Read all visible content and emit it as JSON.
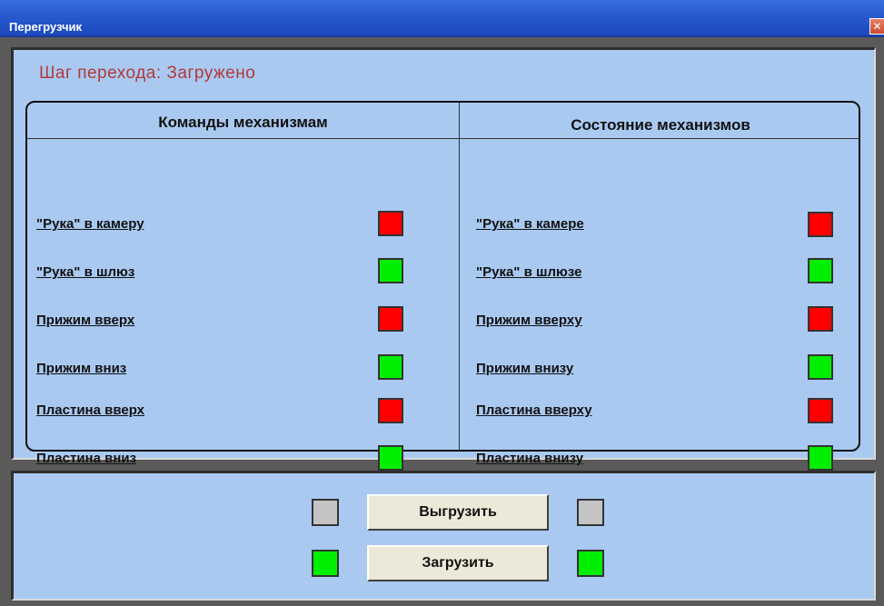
{
  "window": {
    "title": "Перегрузчик",
    "close_glyph": "✕"
  },
  "step": {
    "text": "Шаг перехода:  Загружено"
  },
  "commands": {
    "header": "Команды механизмам",
    "items": [
      {
        "label": "\"Рука\" в камеру",
        "status": "red"
      },
      {
        "label": "\"Рука\" в шлюз",
        "status": "green"
      },
      {
        "label": "Прижим вверх",
        "status": "red"
      },
      {
        "label": "Прижим вниз",
        "status": "green"
      },
      {
        "label": "Пластина вверх",
        "status": "red"
      },
      {
        "label": "Пластина вниз",
        "status": "green"
      }
    ]
  },
  "states": {
    "header": "Состояние механизмов",
    "items": [
      {
        "label": "\"Рука\" в камере",
        "status": "red"
      },
      {
        "label": "\"Рука\" в шлюзе",
        "status": "green"
      },
      {
        "label": "Прижим вверху",
        "status": "red"
      },
      {
        "label": "Прижим внизу",
        "status": "green"
      },
      {
        "label": "Пластина вверху",
        "status": "red"
      },
      {
        "label": "Пластина внизу",
        "status": "green"
      }
    ]
  },
  "actions": {
    "unload_label": "Выгрузить",
    "load_label": "Загрузить",
    "unload_status_left": "gray",
    "unload_status_right": "gray",
    "load_status_left": "green",
    "load_status_right": "green"
  },
  "colors": {
    "red": "#ff0000",
    "green": "#00ee00",
    "gray": "#c4c4c4",
    "panel": "#a9c9f1",
    "step_text": "#b03a3a"
  }
}
